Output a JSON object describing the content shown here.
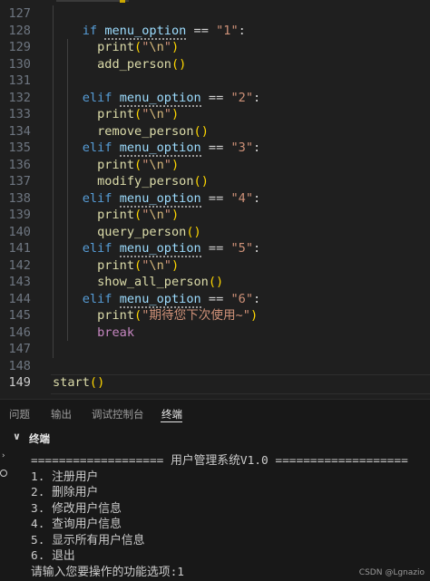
{
  "editor": {
    "lines": [
      {
        "n": "127",
        "segments": []
      },
      {
        "n": "128",
        "segments": [
          {
            "t": "    ",
            "c": ""
          },
          {
            "t": "if",
            "c": "kw"
          },
          {
            "t": " ",
            "c": ""
          },
          {
            "t": "menu_option",
            "c": "var"
          },
          {
            "t": " == ",
            "c": "punc"
          },
          {
            "t": "\"1\"",
            "c": "str"
          },
          {
            "t": ":",
            "c": "punc"
          }
        ]
      },
      {
        "n": "129",
        "segments": [
          {
            "t": "      ",
            "c": ""
          },
          {
            "t": "print",
            "c": "fn"
          },
          {
            "t": "(",
            "c": "paren"
          },
          {
            "t": "\"",
            "c": "str"
          },
          {
            "t": "\\n",
            "c": "esc"
          },
          {
            "t": "\"",
            "c": "str"
          },
          {
            "t": ")",
            "c": "paren"
          }
        ]
      },
      {
        "n": "130",
        "segments": [
          {
            "t": "      ",
            "c": ""
          },
          {
            "t": "add_person",
            "c": "fn"
          },
          {
            "t": "()",
            "c": "paren"
          }
        ]
      },
      {
        "n": "131",
        "segments": []
      },
      {
        "n": "132",
        "segments": [
          {
            "t": "    ",
            "c": ""
          },
          {
            "t": "elif",
            "c": "kw"
          },
          {
            "t": " ",
            "c": ""
          },
          {
            "t": "menu_option",
            "c": "var"
          },
          {
            "t": " == ",
            "c": "punc"
          },
          {
            "t": "\"2\"",
            "c": "str"
          },
          {
            "t": ":",
            "c": "punc"
          }
        ]
      },
      {
        "n": "133",
        "segments": [
          {
            "t": "      ",
            "c": ""
          },
          {
            "t": "print",
            "c": "fn"
          },
          {
            "t": "(",
            "c": "paren"
          },
          {
            "t": "\"",
            "c": "str"
          },
          {
            "t": "\\n",
            "c": "esc"
          },
          {
            "t": "\"",
            "c": "str"
          },
          {
            "t": ")",
            "c": "paren"
          }
        ]
      },
      {
        "n": "134",
        "segments": [
          {
            "t": "      ",
            "c": ""
          },
          {
            "t": "remove_person",
            "c": "fn"
          },
          {
            "t": "()",
            "c": "paren"
          }
        ]
      },
      {
        "n": "135",
        "segments": [
          {
            "t": "    ",
            "c": ""
          },
          {
            "t": "elif",
            "c": "kw"
          },
          {
            "t": " ",
            "c": ""
          },
          {
            "t": "menu_option",
            "c": "var"
          },
          {
            "t": " == ",
            "c": "punc"
          },
          {
            "t": "\"3\"",
            "c": "str"
          },
          {
            "t": ":",
            "c": "punc"
          }
        ]
      },
      {
        "n": "136",
        "segments": [
          {
            "t": "      ",
            "c": ""
          },
          {
            "t": "print",
            "c": "fn"
          },
          {
            "t": "(",
            "c": "paren"
          },
          {
            "t": "\"",
            "c": "str"
          },
          {
            "t": "\\n",
            "c": "esc"
          },
          {
            "t": "\"",
            "c": "str"
          },
          {
            "t": ")",
            "c": "paren"
          }
        ]
      },
      {
        "n": "137",
        "segments": [
          {
            "t": "      ",
            "c": ""
          },
          {
            "t": "modify_person",
            "c": "fn"
          },
          {
            "t": "()",
            "c": "paren"
          }
        ]
      },
      {
        "n": "138",
        "segments": [
          {
            "t": "    ",
            "c": ""
          },
          {
            "t": "elif",
            "c": "kw"
          },
          {
            "t": " ",
            "c": ""
          },
          {
            "t": "menu_option",
            "c": "var"
          },
          {
            "t": " == ",
            "c": "punc"
          },
          {
            "t": "\"4\"",
            "c": "str"
          },
          {
            "t": ":",
            "c": "punc"
          }
        ]
      },
      {
        "n": "139",
        "segments": [
          {
            "t": "      ",
            "c": ""
          },
          {
            "t": "print",
            "c": "fn"
          },
          {
            "t": "(",
            "c": "paren"
          },
          {
            "t": "\"",
            "c": "str"
          },
          {
            "t": "\\n",
            "c": "esc"
          },
          {
            "t": "\"",
            "c": "str"
          },
          {
            "t": ")",
            "c": "paren"
          }
        ]
      },
      {
        "n": "140",
        "segments": [
          {
            "t": "      ",
            "c": ""
          },
          {
            "t": "query_person",
            "c": "fn"
          },
          {
            "t": "()",
            "c": "paren"
          }
        ]
      },
      {
        "n": "141",
        "segments": [
          {
            "t": "    ",
            "c": ""
          },
          {
            "t": "elif",
            "c": "kw"
          },
          {
            "t": " ",
            "c": ""
          },
          {
            "t": "menu_option",
            "c": "var"
          },
          {
            "t": " == ",
            "c": "punc"
          },
          {
            "t": "\"5\"",
            "c": "str"
          },
          {
            "t": ":",
            "c": "punc"
          }
        ]
      },
      {
        "n": "142",
        "segments": [
          {
            "t": "      ",
            "c": ""
          },
          {
            "t": "print",
            "c": "fn"
          },
          {
            "t": "(",
            "c": "paren"
          },
          {
            "t": "\"",
            "c": "str"
          },
          {
            "t": "\\n",
            "c": "esc"
          },
          {
            "t": "\"",
            "c": "str"
          },
          {
            "t": ")",
            "c": "paren"
          }
        ]
      },
      {
        "n": "143",
        "segments": [
          {
            "t": "      ",
            "c": ""
          },
          {
            "t": "show_all_person",
            "c": "fn"
          },
          {
            "t": "()",
            "c": "paren"
          }
        ]
      },
      {
        "n": "144",
        "segments": [
          {
            "t": "    ",
            "c": ""
          },
          {
            "t": "elif",
            "c": "kw"
          },
          {
            "t": " ",
            "c": ""
          },
          {
            "t": "menu_option",
            "c": "var"
          },
          {
            "t": " == ",
            "c": "punc"
          },
          {
            "t": "\"6\"",
            "c": "str"
          },
          {
            "t": ":",
            "c": "punc"
          }
        ]
      },
      {
        "n": "145",
        "segments": [
          {
            "t": "      ",
            "c": ""
          },
          {
            "t": "print",
            "c": "fn"
          },
          {
            "t": "(",
            "c": "paren"
          },
          {
            "t": "\"期待您下次使用~\"",
            "c": "str"
          },
          {
            "t": ")",
            "c": "paren"
          }
        ]
      },
      {
        "n": "146",
        "segments": [
          {
            "t": "      ",
            "c": ""
          },
          {
            "t": "break",
            "c": "kw2"
          }
        ]
      },
      {
        "n": "147",
        "segments": []
      },
      {
        "n": "148",
        "segments": []
      },
      {
        "n": "149",
        "segments": [
          {
            "t": "start",
            "c": "fn"
          },
          {
            "t": "()",
            "c": "paren"
          }
        ],
        "active": true
      }
    ]
  },
  "panel": {
    "tabs": [
      {
        "label": "问题",
        "active": false
      },
      {
        "label": "输出",
        "active": false
      },
      {
        "label": "调试控制台",
        "active": false
      },
      {
        "label": "终端",
        "active": true
      }
    ]
  },
  "terminal": {
    "title": "终端",
    "lines": [
      "=================== 用户管理系统V1.0 ===================",
      "1. 注册用户",
      "2. 删除用户",
      "3. 修改用户信息",
      "4. 查询用户信息",
      "5. 显示所有用户信息",
      "6. 退出",
      "请输入您要操作的功能选项:1"
    ]
  },
  "watermark": "CSDN @Lgnazio",
  "colors": {
    "background": "#1f1f1f",
    "keyword": "#569cd6",
    "control_keyword": "#c586c0",
    "function": "#dcdcaa",
    "variable": "#9cdcfe",
    "string": "#ce9178",
    "bracket": "#ffd700"
  }
}
